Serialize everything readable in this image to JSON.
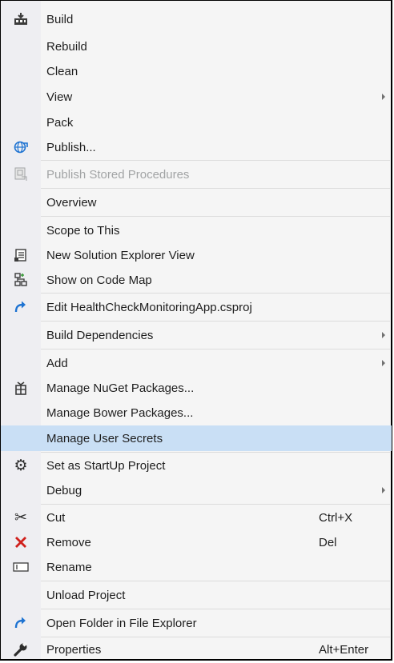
{
  "menu": {
    "items": [
      {
        "label": "Build",
        "icon": "build-icon"
      },
      {
        "label": "Rebuild"
      },
      {
        "label": "Clean"
      },
      {
        "label": "View",
        "submenu": true
      },
      {
        "label": "Pack"
      },
      {
        "label": "Publish...",
        "icon": "publish-globe-icon"
      },
      {
        "label": "Publish Stored Procedures",
        "icon": "database-icon",
        "disabled": true
      },
      {
        "label": "Overview"
      },
      {
        "label": "Scope to This"
      },
      {
        "label": "New Solution Explorer View",
        "icon": "solution-explorer-icon"
      },
      {
        "label": "Show on Code Map",
        "icon": "code-map-icon"
      },
      {
        "label": "Edit HealthCheckMonitoringApp.csproj",
        "icon": "edit-arrow-icon"
      },
      {
        "label": "Build Dependencies",
        "submenu": true
      },
      {
        "label": "Add",
        "submenu": true
      },
      {
        "label": "Manage NuGet Packages...",
        "icon": "nuget-icon"
      },
      {
        "label": "Manage Bower Packages..."
      },
      {
        "label": "Manage User Secrets",
        "highlighted": true
      },
      {
        "label": "Set as StartUp Project",
        "icon": "gear-icon"
      },
      {
        "label": "Debug",
        "submenu": true
      },
      {
        "label": "Cut",
        "icon": "scissors-icon",
        "shortcut": "Ctrl+X"
      },
      {
        "label": "Remove",
        "icon": "remove-x-icon",
        "shortcut": "Del"
      },
      {
        "label": "Rename",
        "icon": "rename-icon"
      },
      {
        "label": "Unload Project"
      },
      {
        "label": "Open Folder in File Explorer",
        "icon": "open-folder-arrow-icon"
      },
      {
        "label": "Properties",
        "icon": "wrench-icon",
        "shortcut": "Alt+Enter"
      }
    ]
  },
  "colors": {
    "highlight": "#c9dff5",
    "disabled_text": "#a2a4a5",
    "accent_blue": "#1e73d2",
    "remove_red": "#d0201c"
  }
}
